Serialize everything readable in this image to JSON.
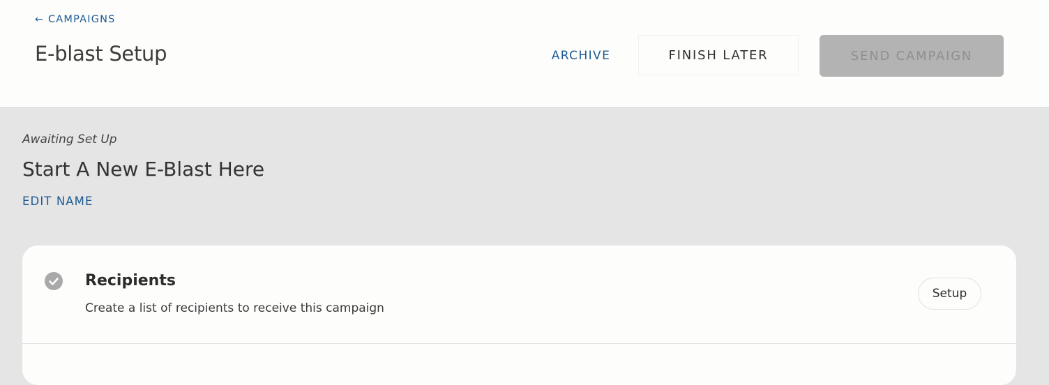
{
  "header": {
    "back_arrow": "←",
    "back_label": "CAMPAIGNS",
    "title": "E-blast Setup",
    "archive_label": "ARCHIVE",
    "finish_later_label": "FINISH LATER",
    "send_campaign_label": "SEND CAMPAIGN"
  },
  "campaign": {
    "status": "Awaiting Set Up",
    "name": "Start A New E-Blast Here",
    "edit_name_label": "EDIT NAME"
  },
  "steps": [
    {
      "icon": "check-circle-icon",
      "title": "Recipients",
      "description": "Create a list of recipients to receive this campaign",
      "action_label": "Setup"
    }
  ],
  "colors": {
    "link": "#1e5b94",
    "background": "#e5e5e5",
    "card": "#fdfdfc",
    "disabled_button": "#b3b3b3",
    "check_icon": "#a9a9a9"
  }
}
